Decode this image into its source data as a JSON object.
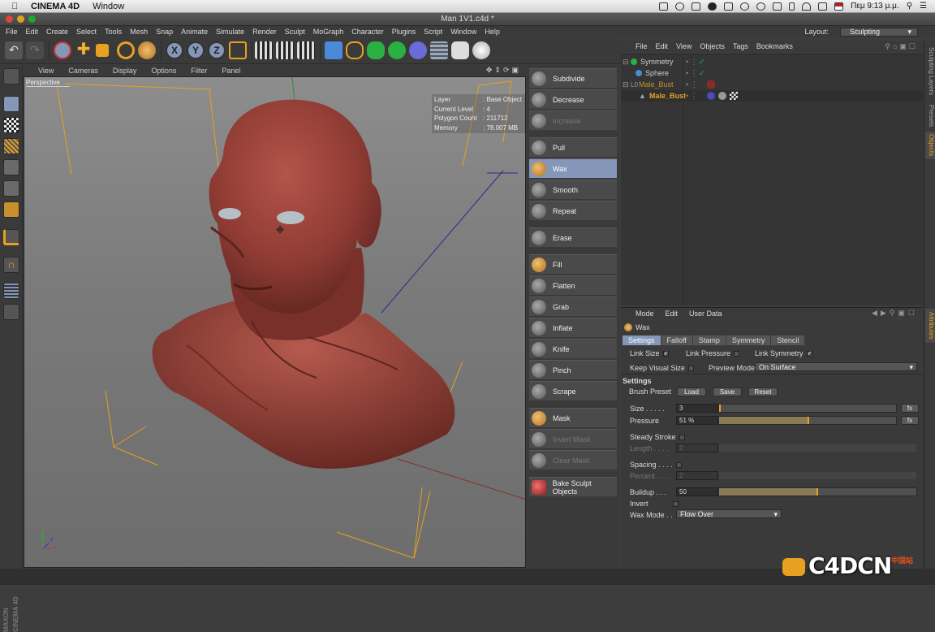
{
  "macbar": {
    "app_name": "CINEMA 4D",
    "window_menu": "Window",
    "clock": "Πεμ 9:13 μ.μ."
  },
  "titlebar": {
    "title": "Man 1V1.c4d *"
  },
  "menu": {
    "items": [
      "File",
      "Edit",
      "Create",
      "Select",
      "Tools",
      "Mesh",
      "Snap",
      "Animate",
      "Simulate",
      "Render",
      "Sculpt",
      "MoGraph",
      "Character",
      "Plugins",
      "Script",
      "Window",
      "Help"
    ],
    "layout_label": "Layout:",
    "layout_value": "Sculpting"
  },
  "viewport": {
    "menu": [
      "View",
      "Cameras",
      "Display",
      "Options",
      "Filter",
      "Panel"
    ],
    "label": "Perspective",
    "hud": [
      {
        "k": "Layer",
        "v": ": Base Object"
      },
      {
        "k": "Current Level",
        "v": ": 4"
      },
      {
        "k": "Polygon Count",
        "v": ": 211712"
      },
      {
        "k": "Memory",
        "v": ": 78.007 MB"
      }
    ],
    "axis_x": "x",
    "axis_y": "y",
    "axis_z": "z"
  },
  "sculpt_tools": [
    {
      "label": "Subdivide",
      "state": "normal"
    },
    {
      "label": "Decrease",
      "state": "normal"
    },
    {
      "label": "Increase",
      "state": "disabled"
    },
    {
      "label": "Pull",
      "state": "normal"
    },
    {
      "label": "Wax",
      "state": "active"
    },
    {
      "label": "Smooth",
      "state": "normal"
    },
    {
      "label": "Repeat",
      "state": "normal"
    },
    {
      "label": "Erase",
      "state": "normal"
    },
    {
      "label": "Fill",
      "state": "normal"
    },
    {
      "label": "Flatten",
      "state": "normal"
    },
    {
      "label": "Grab",
      "state": "normal"
    },
    {
      "label": "Inflate",
      "state": "normal"
    },
    {
      "label": "Knife",
      "state": "normal"
    },
    {
      "label": "Pinch",
      "state": "normal"
    },
    {
      "label": "Scrape",
      "state": "normal"
    },
    {
      "label": "Mask",
      "state": "normal"
    },
    {
      "label": "Invert Mask",
      "state": "disabled"
    },
    {
      "label": "Clear Mask",
      "state": "disabled"
    },
    {
      "label": "Bake Sculpt Objects",
      "state": "normal"
    }
  ],
  "objects": {
    "menu": [
      "File",
      "Edit",
      "View",
      "Objects",
      "Tags",
      "Bookmarks"
    ],
    "rows": [
      {
        "name": "Symmetry",
        "color": "#dddddd"
      },
      {
        "name": "Sphere",
        "color": "#dddddd"
      },
      {
        "name": "Male_Bust",
        "color": "#c8902a"
      },
      {
        "name": "Male_Bust",
        "color": "#e8a020"
      }
    ]
  },
  "attributes": {
    "menu": [
      "Mode",
      "Edit",
      "User Data"
    ],
    "object": "Wax",
    "tabs": [
      "Settings",
      "Falloff",
      "Stamp",
      "Symmetry",
      "Stencil"
    ],
    "link_size": "Link Size",
    "link_pressure": "Link Pressure",
    "link_symmetry": "Link Symmetry",
    "keep_visual": "Keep Visual Size",
    "preview_mode_label": "Preview Mode",
    "preview_mode": "On Surface",
    "settings_heading": "Settings",
    "brush_preset": "Brush Preset",
    "load": "Load",
    "save": "Save",
    "reset": "Reset",
    "size_label": "Size . . . . .",
    "size": "3",
    "size_frac": 0.01,
    "pressure_label": "Pressure",
    "pressure": "51 %",
    "pressure_frac": 0.51,
    "fx": "fx",
    "steady": "Steady Stroke",
    "length_label": "Length . . . .",
    "length": "2",
    "spacing": "Spacing . . . .",
    "percent_label": "Percent . . . .",
    "percent": "2",
    "buildup_label": "Buildup . . .",
    "buildup": "50",
    "buildup_frac": 0.5,
    "invert": "Invert",
    "wax_mode_label": "Wax Mode . .",
    "wax_mode": "Flow Over"
  },
  "side_tabs": [
    "Sculpting Layers",
    "Presets",
    "Objects",
    "Attributes"
  ],
  "maxon": "MAXON CINEMA 4D",
  "watermark": {
    "main": "C4DCN",
    "sub": "中国站"
  },
  "check_mark": "✓"
}
